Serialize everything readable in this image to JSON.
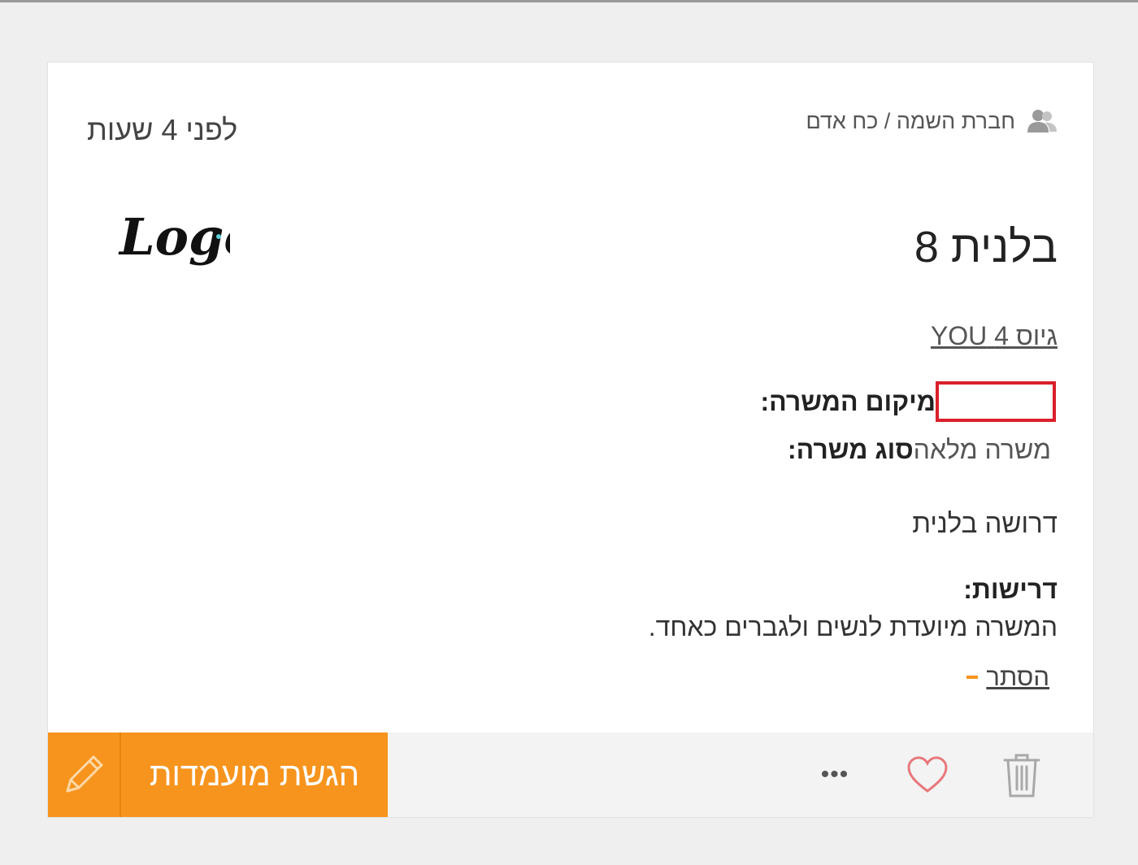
{
  "card": {
    "category": "חברת השמה / כח אדם",
    "posted_time": "לפני 4 שעות",
    "logo_text": "Logo",
    "title": "בלנית 8",
    "company": "גיוס 4 YOU",
    "location_label": "מיקום המשרה:",
    "location_value": "",
    "type_label": "סוג משרה:",
    "type_value": "משרה מלאה",
    "description": "דרושה בלנית",
    "requirements_label": "דרישות:",
    "requirements_text": "המשרה מיועדת לנשים ולגברים כאחד.",
    "hide_label": "הסתר"
  },
  "footer": {
    "apply_label": "הגשת מועמדות",
    "more_label": "•••"
  },
  "icons": {
    "category": "users-icon",
    "apply": "pencil-icon",
    "favorite": "heart-icon",
    "delete": "trash-icon"
  },
  "colors": {
    "accent": "#f7941d",
    "redaction": "#d9202b",
    "heart": "#e8787c"
  }
}
